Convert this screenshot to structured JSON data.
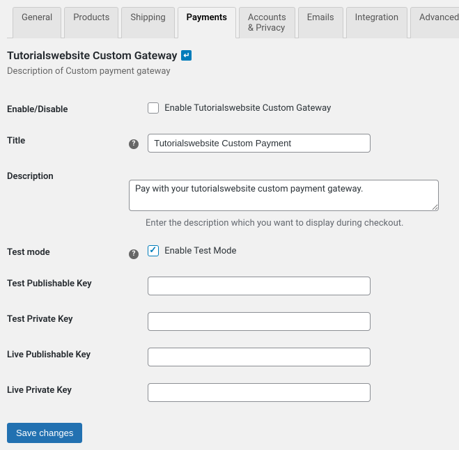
{
  "tabs": [
    {
      "label": "General"
    },
    {
      "label": "Products"
    },
    {
      "label": "Shipping"
    },
    {
      "label": "Payments",
      "active": true
    },
    {
      "label": "Accounts & Privacy"
    },
    {
      "label": "Emails"
    },
    {
      "label": "Integration"
    },
    {
      "label": "Advanced"
    }
  ],
  "page": {
    "title": "Tutorialswebsite Custom Gateway",
    "description": "Description of Custom payment gateway"
  },
  "fields": {
    "enable_disable": {
      "label": "Enable/Disable",
      "checkbox_label": "Enable Tutorialswebsite Custom Gateway",
      "checked": false
    },
    "title": {
      "label": "Title",
      "value": "Tutorialswebsite Custom Payment"
    },
    "description": {
      "label": "Description",
      "value": "Pay with your tutorialswebsite custom payment gateway.",
      "help": "Enter the description which you want to display during checkout."
    },
    "test_mode": {
      "label": "Test mode",
      "checkbox_label": "Enable Test Mode",
      "checked": true
    },
    "test_publishable_key": {
      "label": "Test Publishable Key",
      "value": ""
    },
    "test_private_key": {
      "label": "Test Private Key",
      "value": ""
    },
    "live_publishable_key": {
      "label": "Live Publishable Key",
      "value": ""
    },
    "live_private_key": {
      "label": "Live Private Key",
      "value": ""
    }
  },
  "buttons": {
    "save": "Save changes"
  }
}
